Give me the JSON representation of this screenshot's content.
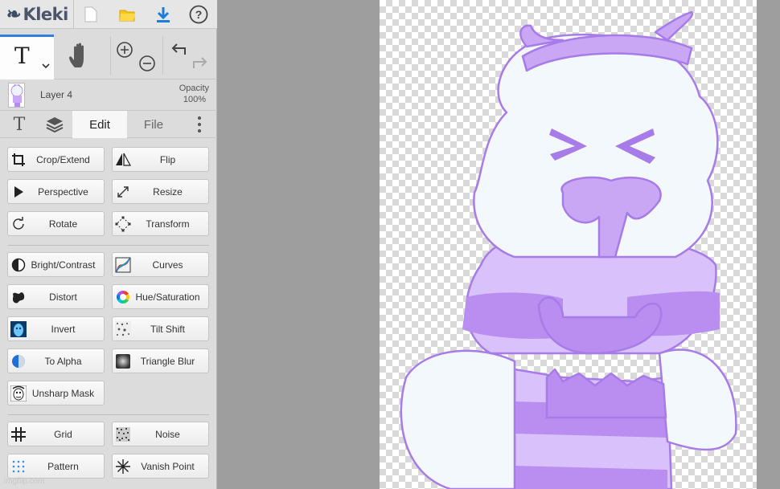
{
  "app": {
    "name": "Kleki"
  },
  "topbar": {
    "buttons": [
      {
        "name": "new-image",
        "icon": "new-file-icon"
      },
      {
        "name": "open",
        "icon": "folder-icon"
      },
      {
        "name": "save",
        "icon": "download-icon"
      },
      {
        "name": "help",
        "icon": "help-icon"
      }
    ]
  },
  "tools": {
    "active": "text",
    "text_glyph": "T",
    "items": [
      "text-tool",
      "hand-tool",
      "zoom-in",
      "zoom-out",
      "undo",
      "redo"
    ]
  },
  "layer": {
    "name": "Layer 4",
    "opacity_label": "Opacity",
    "opacity_value": "100%"
  },
  "tabs": {
    "edit": "Edit",
    "file": "File",
    "active": "Edit"
  },
  "filters": {
    "group1": [
      {
        "label": "Crop/Extend",
        "icon": "crop-icon"
      },
      {
        "label": "Flip",
        "icon": "flip-icon"
      },
      {
        "label": "Perspective",
        "icon": "perspective-icon"
      },
      {
        "label": "Resize",
        "icon": "resize-icon"
      },
      {
        "label": "Rotate",
        "icon": "rotate-icon"
      },
      {
        "label": "Transform",
        "icon": "transform-icon"
      }
    ],
    "group2": [
      {
        "label": "Bright/Contrast",
        "icon": "brightness-icon"
      },
      {
        "label": "Curves",
        "icon": "curves-icon"
      },
      {
        "label": "Distort",
        "icon": "distort-icon"
      },
      {
        "label": "Hue/Saturation",
        "icon": "hue-wheel-icon"
      },
      {
        "label": "Invert",
        "icon": "invert-icon"
      },
      {
        "label": "Tilt Shift",
        "icon": "tilt-shift-icon"
      },
      {
        "label": "To Alpha",
        "icon": "to-alpha-icon"
      },
      {
        "label": "Triangle Blur",
        "icon": "blur-icon"
      },
      {
        "label": "Unsharp Mask",
        "icon": "unsharp-icon"
      }
    ],
    "group3": [
      {
        "label": "Grid",
        "icon": "grid-icon"
      },
      {
        "label": "Noise",
        "icon": "noise-icon"
      },
      {
        "label": "Pattern",
        "icon": "pattern-icon"
      },
      {
        "label": "Vanish Point",
        "icon": "vanish-point-icon"
      }
    ]
  },
  "watermark": "imgflip.com",
  "colors": {
    "accent": "#2f7fd8",
    "sidebar_bg": "#dcdcdc",
    "workspace_bg": "#9e9e9e",
    "artwork_purple": "#b98ef0",
    "artwork_light": "#f3f8fc",
    "artwork_line": "#a77be8"
  }
}
